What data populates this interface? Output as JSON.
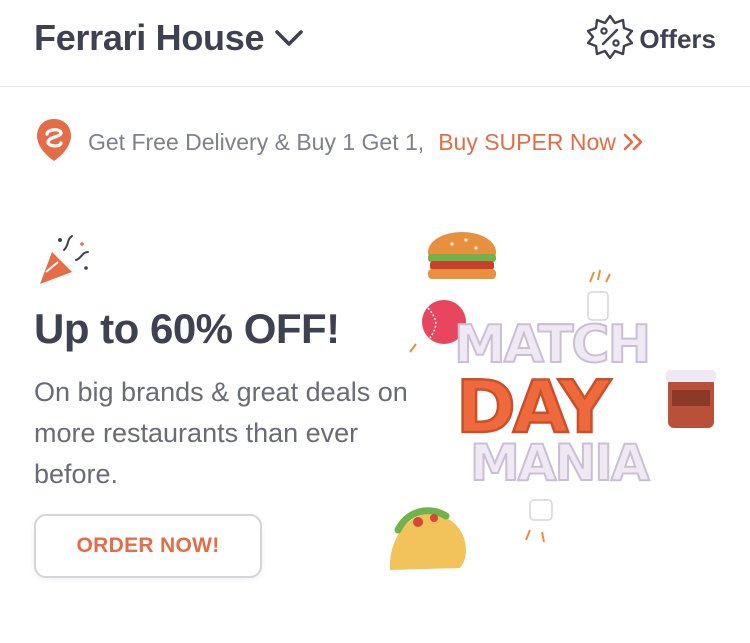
{
  "header": {
    "location_title": "Ferrari House",
    "offers_label": "Offers",
    "offers_icon": "percent-badge-icon",
    "chevron_icon": "chevron-down-icon"
  },
  "super_strip": {
    "icon": "swiggy-super-logo-icon",
    "text": "Get Free Delivery & Buy 1 Get 1,",
    "link_label": "Buy SUPER Now",
    "link_icon": "double-chevron-right-icon"
  },
  "banner": {
    "party_icon": "party-popper-icon",
    "headline": "Up to 60% OFF!",
    "subtext": "On big brands & great deals on more restaurants than ever before.",
    "cta_label": "ORDER NOW!",
    "art": {
      "line1": "MATCH",
      "line2": "DAY",
      "line3": "MANIA"
    }
  },
  "colors": {
    "accent": "#e46d47",
    "text_dark": "#3d4152",
    "text_muted": "#7e808c",
    "border": "#e6e6ea"
  }
}
